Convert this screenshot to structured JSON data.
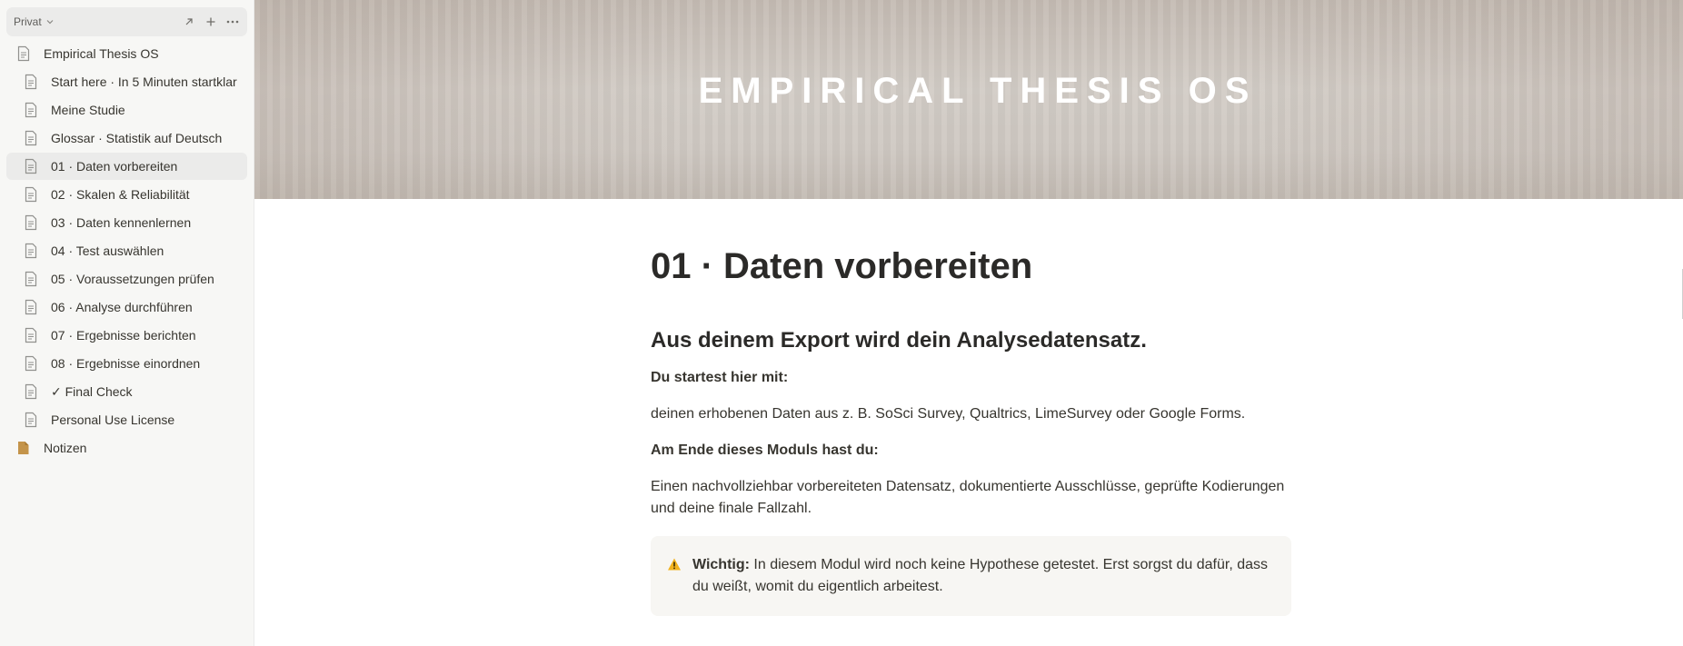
{
  "sidebar": {
    "workspace_name": "Privat",
    "items": [
      {
        "label": "Empirical Thesis OS",
        "level": 0,
        "icon": "document-icon"
      },
      {
        "label": "Start here · In 5 Minuten startklar",
        "level": 1,
        "icon": "document-icon"
      },
      {
        "label": "Meine Studie",
        "level": 1,
        "icon": "document-icon"
      },
      {
        "label": "Glossar · Statistik auf Deutsch",
        "level": 1,
        "icon": "document-icon"
      },
      {
        "label": "01 · Daten vorbereiten",
        "level": 1,
        "icon": "document-icon",
        "active": true
      },
      {
        "label": "02 · Skalen & Reliabilität",
        "level": 1,
        "icon": "document-icon"
      },
      {
        "label": "03 · Daten kennenlernen",
        "level": 1,
        "icon": "document-icon"
      },
      {
        "label": "04 · Test auswählen",
        "level": 1,
        "icon": "document-icon"
      },
      {
        "label": "05 · Voraussetzungen prüfen",
        "level": 1,
        "icon": "document-icon"
      },
      {
        "label": "06 · Analyse durchführen",
        "level": 1,
        "icon": "document-icon"
      },
      {
        "label": "07 · Ergebnisse berichten",
        "level": 1,
        "icon": "document-icon"
      },
      {
        "label": "08 · Ergebnisse einordnen",
        "level": 1,
        "icon": "document-icon"
      },
      {
        "label": "✓ Final Check",
        "level": 1,
        "icon": "document-icon"
      },
      {
        "label": "Personal Use License",
        "level": 1,
        "icon": "document-icon"
      },
      {
        "label": "Notizen",
        "level": 0,
        "icon": "folder-icon"
      }
    ]
  },
  "cover": {
    "title": "EMPIRICAL THESIS OS"
  },
  "page": {
    "title": "01 · Daten vorbereiten",
    "heading": "Aus deinem Export wird dein Analysedatensatz.",
    "start_label": "Du startest hier mit:",
    "start_text": "deinen erhobenen Daten aus z. B. SoSci Survey, Qualtrics, LimeSurvey oder Google Forms.",
    "end_label": "Am Ende dieses Moduls hast du:",
    "end_text": "Einen nachvollziehbar vorbereiteten Datensatz, dokumentierte Ausschlüsse, geprüfte Kodierungen und deine finale Fallzahl.",
    "callout": {
      "label": "Wichtig:",
      "text": " In diesem Modul wird noch keine Hypothese getestet. Erst sorgst du dafür, dass du weißt, womit du eigentlich arbeitest."
    }
  },
  "colors": {
    "sidebar_bg": "#f7f7f5",
    "active_item_bg": "#ebebea",
    "text": "#37352f",
    "callout_bg": "#f7f6f3",
    "folder_icon": "#c4944a",
    "warning_icon": "#f2b21c"
  }
}
